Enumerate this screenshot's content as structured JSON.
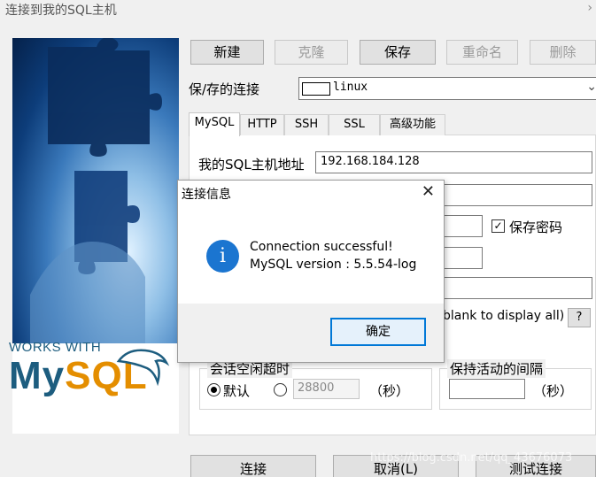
{
  "window": {
    "title": "连接到我的SQL主机"
  },
  "side_image": {
    "works_with": "WORKS WITH",
    "logo_my": "My",
    "logo_sql": "SQL"
  },
  "toolbar": {
    "new": "新建",
    "clone": "克隆",
    "save": "保存",
    "rename": "重命名",
    "delete": "删除"
  },
  "saved_connection": {
    "label": "保/存的连接",
    "value": "linux"
  },
  "tabs": [
    "MySQL",
    "HTTP",
    "SSH",
    "SSL",
    "高级功能"
  ],
  "mysql_tab": {
    "host_label": "我的SQL主机地址",
    "host_value": "192.168.184.128",
    "save_password_label": "保存密码",
    "save_password_checked": "✓",
    "database_hint": "blank to display all)",
    "help_label": "?"
  },
  "session_timeout": {
    "title": "会话空闲超时",
    "default_label": "默认",
    "custom_value": "28800",
    "unit": "（秒）"
  },
  "keepalive": {
    "title": "保持活动的间隔",
    "unit": "（秒）"
  },
  "footer": {
    "connect": "连接",
    "cancel": "取消(L)",
    "test": "测试连接",
    "watermark": "https://blog.csdn.net/qq_43676073"
  },
  "dialog": {
    "title": "连接信息",
    "message_line1": "Connection successful!",
    "message_line2": "MySQL version : 5.5.54-log",
    "ok": "确定",
    "icon_glyph": "i"
  }
}
